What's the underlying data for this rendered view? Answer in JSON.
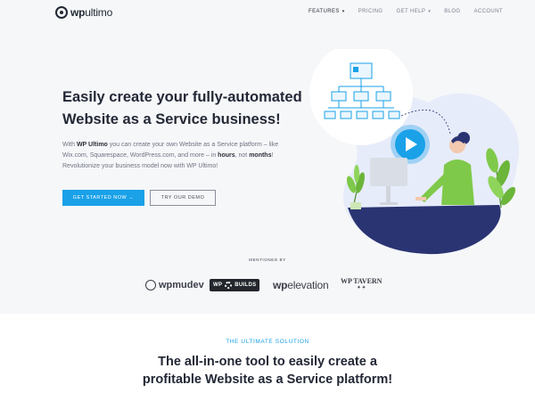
{
  "header": {
    "logo_bold": "wp",
    "logo_rest": "ultimo",
    "nav": [
      {
        "label": "FEATURES",
        "caret": "▾",
        "active": true
      },
      {
        "label": "PRICING"
      },
      {
        "label": "GET HELP",
        "caret": "▾"
      },
      {
        "label": "BLOG"
      },
      {
        "label": "ACCOUNT"
      }
    ]
  },
  "hero": {
    "headline_line1": "Easily create your fully-automated",
    "headline_line2": "Website as a Service business!",
    "intro": {
      "p1": "With ",
      "p1_bold": "WP Ultimo",
      "p2": " you can create your own Website as a Service platform – like Wix.com, Squarespace, WordPress.com, and more – in ",
      "p2_bold1": "hours",
      "p3": ", not ",
      "p3_bold2": "months",
      "p4": "! Revolutionize your business model now with WP Ultimo!"
    },
    "primary_cta": "GET STARTED NOW →",
    "secondary_cta": "TRY OUR DEMO"
  },
  "mentioned": {
    "label": "MENTIONED BY",
    "wpmudev": "wpmudev",
    "wpbuilds_left": "WP",
    "wpbuilds_right": "BUILDS",
    "wpelevation_bold": "wp",
    "wpelevation_rest": "elevation",
    "wptavern": "WP TAVERN",
    "wptavern_sub": "✦ ✦"
  },
  "solution": {
    "eyebrow": "THE ULTIMATE SOLUTION",
    "line1_a": "The ",
    "line1_b": "all-in-one",
    "line1_c": " tool to easily create a",
    "line2_a": "profitable ",
    "line2_b": "Website as a Service",
    "line2_c": " platform!"
  },
  "colors": {
    "accent": "#1aa1e8",
    "navy": "#2a3473",
    "green": "#7fc94a"
  }
}
